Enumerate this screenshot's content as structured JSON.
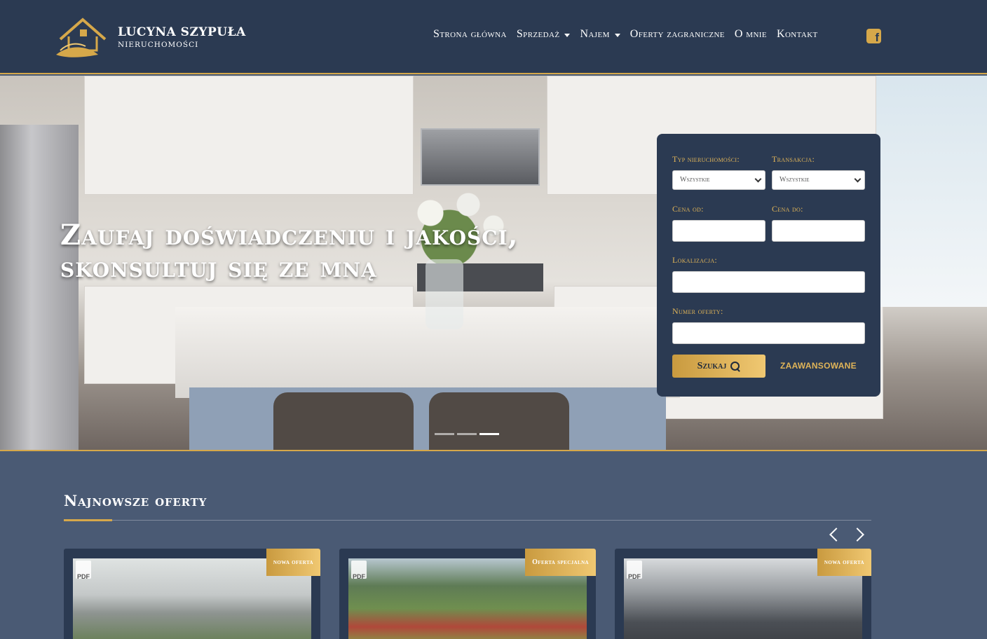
{
  "brand": {
    "name": "LUCYNA SZYPUŁA",
    "subtitle": "NIERUCHOMOŚCI"
  },
  "nav": {
    "items": [
      {
        "label": "Strona główna",
        "dropdown": false
      },
      {
        "label": "Sprzedaż",
        "dropdown": true
      },
      {
        "label": "Najem",
        "dropdown": true
      },
      {
        "label": "Oferty zagraniczne",
        "dropdown": false
      },
      {
        "label": "O mnie",
        "dropdown": false
      },
      {
        "label": "Kontakt",
        "dropdown": false
      }
    ],
    "social_icon": "facebook-icon"
  },
  "hero": {
    "title_line1": "Zaufaj doświadczeniu i jakości,",
    "title_line2": "skonsultuj się ze mną",
    "slides_total": 3,
    "active_slide": 3
  },
  "search": {
    "property_type_label": "Typ nieruchomości:",
    "property_type_value": "Wszystkie",
    "transaction_label": "Transakcja:",
    "transaction_value": "Wszystkie",
    "price_from_label": "Cena od:",
    "price_from_value": "",
    "price_to_label": "Cena do:",
    "price_to_value": "",
    "location_label": "Lokalizacja:",
    "location_value": "",
    "offer_number_label": "Numer oferty:",
    "offer_number_value": "",
    "submit_label": "Szukaj",
    "advanced_label": "ZAAWANSOWANE"
  },
  "latest": {
    "title": "Najnowsze oferty",
    "cards": [
      {
        "badge": "nowa oferta",
        "pdf": "PDF"
      },
      {
        "badge": "Oferta specjalna",
        "pdf": "PDF"
      },
      {
        "badge": "nowa oferta",
        "pdf": "PDF"
      }
    ]
  },
  "colors": {
    "header_bg": "#2b3a52",
    "accent_gold": "#d6a84a",
    "section_bg": "#4a5a74"
  }
}
